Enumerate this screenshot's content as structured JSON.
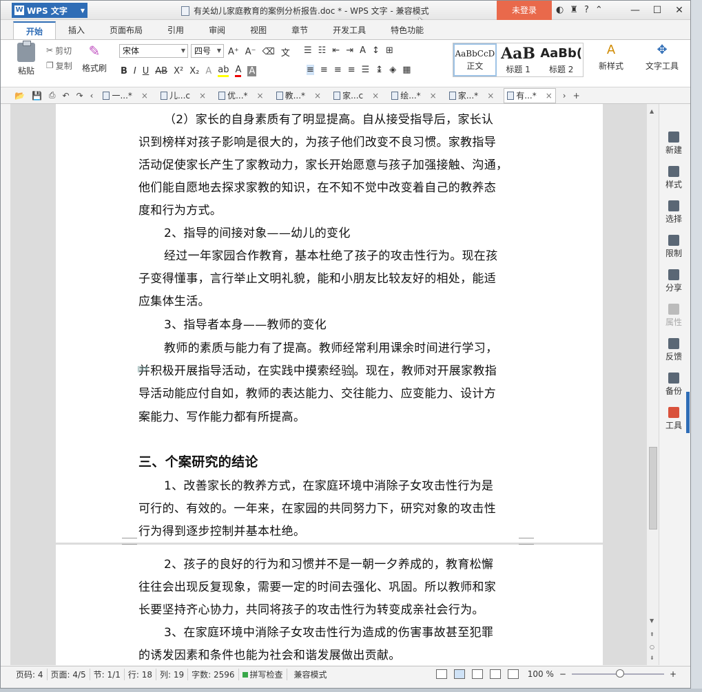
{
  "app": {
    "name": "WPS 文字",
    "title": "有关幼儿家庭教育的案例分析报告.doc * - WPS 文字 - 兼容模式",
    "login": "未登录"
  },
  "tabs": [
    "开始",
    "插入",
    "页面布局",
    "引用",
    "审阅",
    "视图",
    "章节",
    "开发工具",
    "特色功能"
  ],
  "ribbon": {
    "paste": "粘贴",
    "cut": "剪切",
    "copy": "复制",
    "format_painter": "格式刷",
    "font": "宋体",
    "size": "四号",
    "styles": [
      {
        "preview": "AaBbCcD",
        "label": "正文"
      },
      {
        "preview": "AaB",
        "label": "标题 1"
      },
      {
        "preview": "AaBb(",
        "label": "标题 2"
      }
    ],
    "new_style": "新样式",
    "text_tools": "文字工具"
  },
  "doc_tabs": [
    "一...*",
    "儿...c",
    "优...*",
    "教...*",
    "家...c",
    "绘...*",
    "家...*",
    "有...*"
  ],
  "content": {
    "p1": [
      "（2）家长的自身素质有了明显提高。自从接受指导后，家长认",
      "识到榜样对孩子影响是很大的，为孩子他们改变不良习惯。家教指导",
      "活动促使家长产生了家教动力，家长开始愿意与孩子加强接触、沟通，",
      "他们能自愿地去探求家教的知识，在不知不觉中改变着自己的教养态",
      "度和行为方式。"
    ],
    "h2": "2、指导的间接对象——幼儿的变化",
    "p2": [
      "经过一年家园合作教育，基本杜绝了孩子的攻击性行为。现在孩",
      "子变得懂事，言行举止文明礼貌，能和小朋友比较友好的相处，能适",
      "应集体生活。"
    ],
    "h3": "3、指导者本身——教师的变化",
    "p3a": "教师的素质与能力有了提高。教师经常利用课余时间进行学习，",
    "p3b_pre": "并积极开展指导活动，在实践中摸索经验",
    "p3b_post": "。现在，教师对开展家教指",
    "p3c": [
      "导活动能应付自如，教师的表达能力、交往能力、应变能力、设计方",
      "案能力、写作能力都有所提高。"
    ],
    "section": "三、个案研究的结论",
    "c1": [
      "1、改善家长的教养方式，在家庭环境中消除子女攻击性行为是",
      "可行的、有效的。一年来，在家园的共同努力下，研究对象的攻击性",
      "行为得到逐步控制并基本杜绝。"
    ],
    "c2": [
      "2、孩子的良好的行为和习惯并不是一朝一夕养成的，教育松懈",
      "往往会出现反复现象，需要一定的时间去强化、巩固。所以教师和家",
      "长要坚持齐心协力，共同将孩子的攻击性行为转变成亲社会行为。"
    ],
    "c3": [
      "3、在家庭环境中消除子女攻击性行为造成的伤害事故甚至犯罪",
      "的诱发因素和条件也能为社会和谐发展做出贡献。"
    ]
  },
  "right_panel": [
    "新建",
    "样式",
    "选择",
    "限制",
    "分享",
    "属性",
    "反馈",
    "备份",
    "工具"
  ],
  "status": {
    "page": "页码: 4",
    "pages": "页面: 4/5",
    "section": "节: 1/1",
    "row": "行: 18",
    "col": "列: 19",
    "words": "字数: 2596",
    "spell": "拼写检查",
    "mode": "兼容模式",
    "zoom": "100 %"
  }
}
